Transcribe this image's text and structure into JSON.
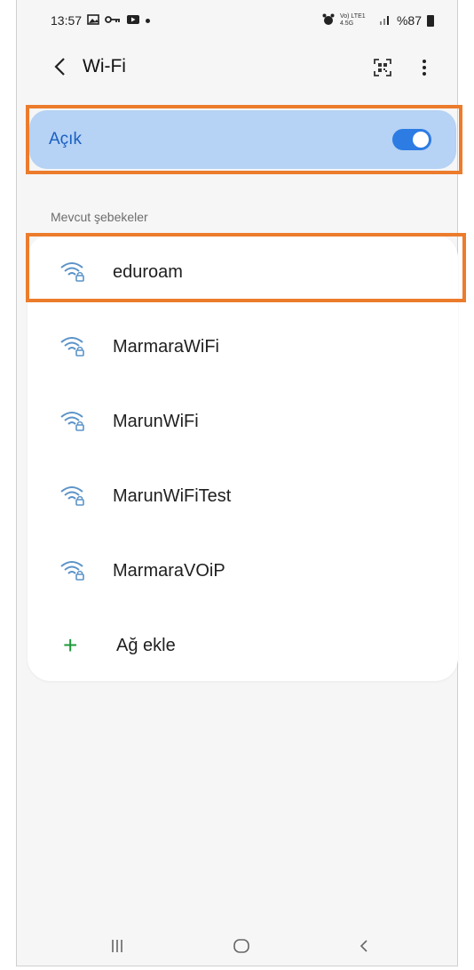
{
  "status_bar": {
    "time": "13:57",
    "network_label": "Vo) LTE1 4.5G",
    "battery": "%87"
  },
  "header": {
    "title": "Wi-Fi"
  },
  "toggle": {
    "label": "Açık",
    "state": true,
    "accent_color": "#2c7ce3"
  },
  "networks": {
    "section_label": "Mevcut şebekeler",
    "items": [
      {
        "name": "eduroam",
        "icon": "wifi-lock-icon"
      },
      {
        "name": "MarmaraWiFi",
        "icon": "wifi-lock-icon"
      },
      {
        "name": "MarunWiFi",
        "icon": "wifi-lock-icon"
      },
      {
        "name": "MarunWiFiTest",
        "icon": "wifi-lock-icon"
      },
      {
        "name": "MarmaraVOiP",
        "icon": "wifi-lock-icon"
      }
    ],
    "add_label": "Ağ ekle"
  },
  "highlight_color": "#ec7c2c"
}
